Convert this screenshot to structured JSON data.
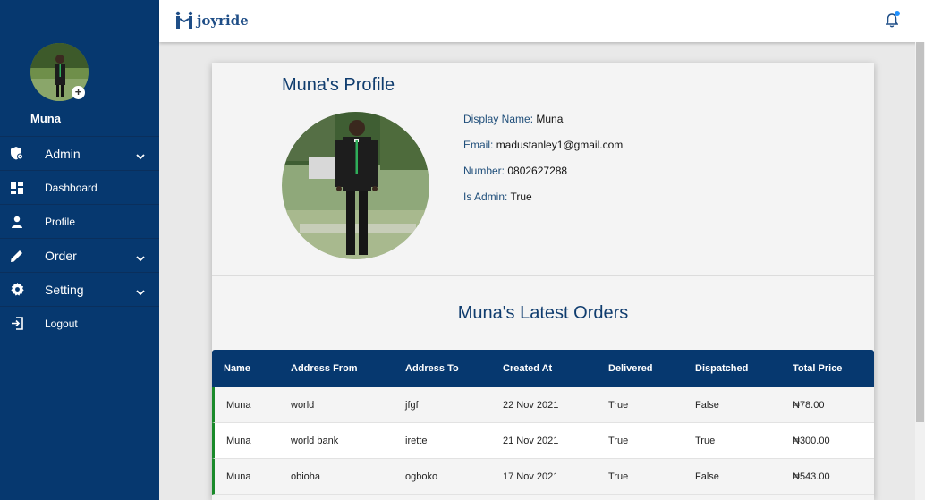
{
  "sidebar": {
    "user_name": "Muna",
    "items": [
      {
        "label": "Admin",
        "icon": "admin-shield-icon",
        "has_chevron": true
      },
      {
        "label": "Dashboard",
        "icon": "dashboard-icon",
        "has_chevron": false
      },
      {
        "label": "Profile",
        "icon": "person-icon",
        "has_chevron": false
      },
      {
        "label": "Order",
        "icon": "pencil-icon",
        "has_chevron": true
      },
      {
        "label": "Setting",
        "icon": "gear-icon",
        "has_chevron": true
      },
      {
        "label": "Logout",
        "icon": "logout-icon",
        "has_chevron": false
      }
    ]
  },
  "topbar": {
    "brand": "joyride"
  },
  "profile": {
    "title": "Muna's Profile",
    "details": [
      {
        "label": "Display Name:",
        "value": "Muna"
      },
      {
        "label": "Email:",
        "value": "madustanley1@gmail.com"
      },
      {
        "label": "Number:",
        "value": "0802627288"
      },
      {
        "label": "Is Admin:",
        "value": "True"
      }
    ]
  },
  "orders": {
    "title": "Muna's Latest Orders",
    "columns": [
      "Name",
      "Address From",
      "Address To",
      "Created At",
      "Delivered",
      "Dispatched",
      "Total Price"
    ],
    "rows": [
      [
        "Muna",
        "world",
        "jfgf",
        "22 Nov 2021",
        "True",
        "False",
        "₦78.00"
      ],
      [
        "Muna",
        "world bank",
        "irette",
        "21 Nov 2021",
        "True",
        "True",
        "₦300.00"
      ],
      [
        "Muna",
        "obioha",
        "ogboko",
        "17 Nov 2021",
        "True",
        "False",
        "₦543.00"
      ]
    ]
  },
  "colors": {
    "sidebar_bg": "#06386f",
    "accent_text": "#0f3c6e",
    "row_marker": "#1a8a2a",
    "notification_dot": "#1e90ff"
  }
}
